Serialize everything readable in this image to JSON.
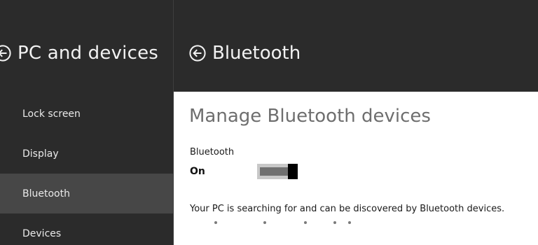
{
  "left_pane": {
    "title": "PC and devices",
    "back_icon": "back-arrow-circle-icon",
    "nav_items": [
      {
        "label": "Lock screen",
        "selected": false
      },
      {
        "label": "Display",
        "selected": false
      },
      {
        "label": "Bluetooth",
        "selected": true
      },
      {
        "label": "Devices",
        "selected": false
      }
    ]
  },
  "right_pane": {
    "title": "Bluetooth",
    "back_icon": "back-arrow-circle-icon",
    "section_title": "Manage Bluetooth devices",
    "bluetooth_toggle": {
      "label": "Bluetooth",
      "state": "On",
      "is_on": true
    },
    "status_text": "Your PC is searching for and can be discovered by Bluetooth devices.",
    "progress_indicator": "searching-dots"
  },
  "colors": {
    "pane_background": "#2b2b2b",
    "selected_nav": "#474747",
    "content_background": "#ffffff",
    "heading_gray": "#6e6e6e",
    "toggle_thumb": "#000000",
    "toggle_fill": "#707070"
  }
}
